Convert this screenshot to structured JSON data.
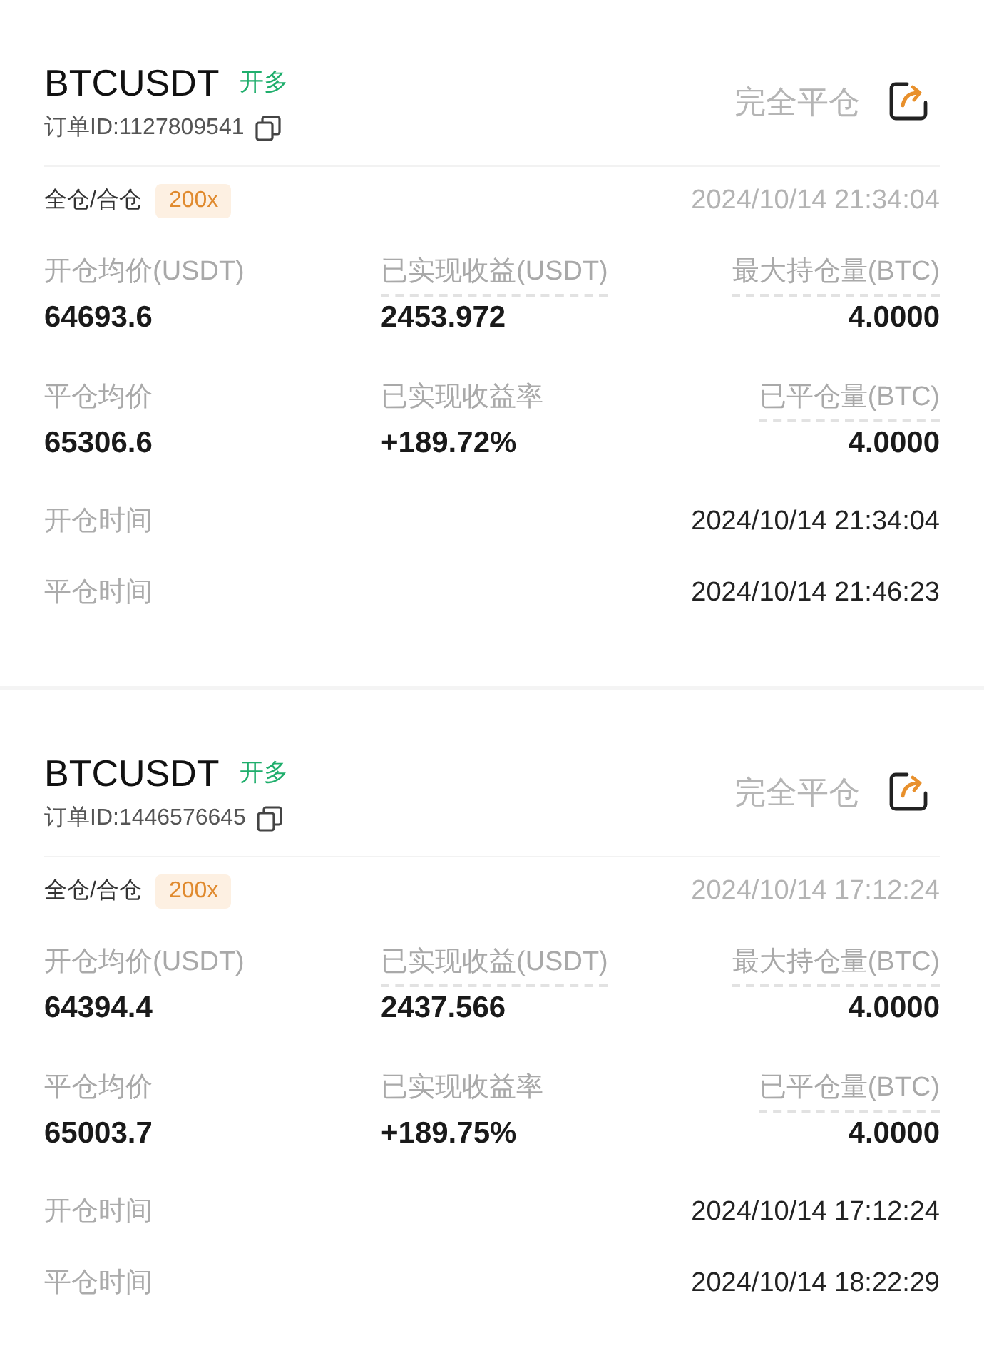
{
  "orders": [
    {
      "symbol": "BTCUSDT",
      "side": "开多",
      "close_button": "完全平仓",
      "order_id": "订单ID:1127809541",
      "margin_mode": "全仓/合仓",
      "leverage": "200x",
      "timestamp": "2024/10/14 21:34:04",
      "stats": [
        {
          "label": "开仓均价(USDT)",
          "value": "64693.6",
          "dashed": false
        },
        {
          "label": "已实现收益(USDT)",
          "value": "2453.972",
          "dashed": true
        },
        {
          "label": "最大持仓量(BTC)",
          "value": "4.0000",
          "dashed": true
        },
        {
          "label": "平仓均价",
          "value": "65306.6",
          "dashed": false
        },
        {
          "label": "已实现收益率",
          "value": "+189.72%",
          "dashed": false
        },
        {
          "label": "已平仓量(BTC)",
          "value": "4.0000",
          "dashed": true
        }
      ],
      "times": [
        {
          "label": "开仓时间",
          "value": "2024/10/14 21:34:04"
        },
        {
          "label": "平仓时间",
          "value": "2024/10/14 21:46:23"
        }
      ]
    },
    {
      "symbol": "BTCUSDT",
      "side": "开多",
      "close_button": "完全平仓",
      "order_id": "订单ID:1446576645",
      "margin_mode": "全仓/合仓",
      "leverage": "200x",
      "timestamp": "2024/10/14 17:12:24",
      "stats": [
        {
          "label": "开仓均价(USDT)",
          "value": "64394.4",
          "dashed": false
        },
        {
          "label": "已实现收益(USDT)",
          "value": "2437.566",
          "dashed": true
        },
        {
          "label": "最大持仓量(BTC)",
          "value": "4.0000",
          "dashed": true
        },
        {
          "label": "平仓均价",
          "value": "65003.7",
          "dashed": false
        },
        {
          "label": "已实现收益率",
          "value": "+189.75%",
          "dashed": false
        },
        {
          "label": "已平仓量(BTC)",
          "value": "4.0000",
          "dashed": true
        }
      ],
      "times": [
        {
          "label": "开仓时间",
          "value": "2024/10/14 17:12:24"
        },
        {
          "label": "平仓时间",
          "value": "2024/10/14 18:22:29"
        }
      ]
    }
  ]
}
